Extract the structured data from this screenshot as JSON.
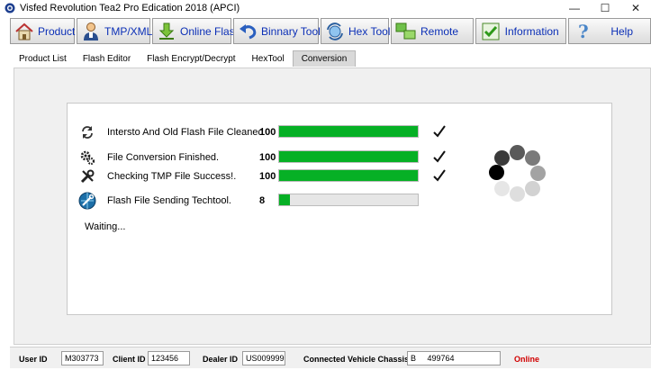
{
  "window": {
    "title": "Visfed Revolution Tea2  Pro Edication 2018 (APCI)",
    "controls": [
      "—",
      "☐",
      "✕"
    ]
  },
  "toolbar": [
    {
      "label": "Product",
      "icon": "home-icon"
    },
    {
      "label": "TMP/XML",
      "icon": "user-icon"
    },
    {
      "label": "Online Flash",
      "icon": "download-arrow-icon"
    },
    {
      "label": "Binnary Tools",
      "icon": "undo-arrow-icon"
    },
    {
      "label": "Hex Tool",
      "icon": "refresh-globe-icon"
    },
    {
      "label": "Remote",
      "icon": "remote-windows-icon"
    },
    {
      "label": "Information",
      "icon": "checkmark-box-icon"
    },
    {
      "label": "Help",
      "icon": "question-mark-icon"
    }
  ],
  "tabs": [
    "Product List",
    "Flash Editor",
    "Flash Encrypt/Decrypt",
    "HexTool",
    "Conversion"
  ],
  "active_tab": "Conversion",
  "steps": [
    {
      "label": "Intersto And Old Flash File Cleaned",
      "value": "100",
      "progress": 1.0,
      "done": true,
      "icon": "refresh-arrows-icon"
    },
    {
      "label": "File Conversion Finished.",
      "value": "100",
      "progress": 1.0,
      "done": true,
      "icon": "gears-icon"
    },
    {
      "label": "Checking TMP File Success!.",
      "value": "100",
      "progress": 1.0,
      "done": true,
      "icon": "tools-icon"
    },
    {
      "label": "Flash File Sending Techtool.",
      "value": "8",
      "progress": 0.08,
      "done": false,
      "icon": "globe-wrench-icon"
    }
  ],
  "status_text": "Waiting...",
  "statusbar": {
    "user_id_label": "User ID",
    "user_id": "M303773",
    "client_id_label": "Client ID",
    "client_id": "123456",
    "dealer_id_label": "Dealer ID",
    "dealer_id": "US009999",
    "chassis_label": "Connected Vehicle Chassis ID",
    "chassis_id": "B     499764",
    "online": "Online"
  },
  "colors": {
    "progress_fill": "#06b025",
    "toolbar_label": "#0b2fb6",
    "online": "#d10000"
  }
}
